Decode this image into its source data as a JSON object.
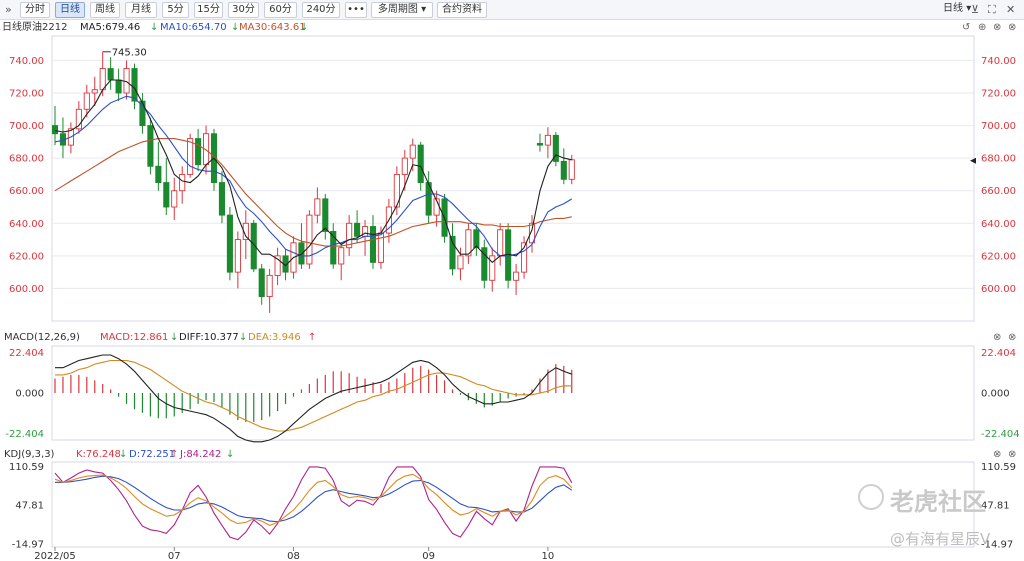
{
  "toolbar": {
    "collapse_icon": "double-chevron-right",
    "buttons": [
      "分时",
      "日线",
      "周线",
      "月线",
      "5分",
      "15分",
      "30分",
      "60分",
      "240分"
    ],
    "active": "日线",
    "more_label": "•••",
    "multi_period_label": "多周期图",
    "contract_info_label": "合约资料",
    "right_dropdown_label": "日线",
    "icons": [
      "minimize-icon",
      "fullscreen-icon",
      "close-icon"
    ]
  },
  "price_header": {
    "period": "日线",
    "symbol": "原油2212",
    "ma5": "MA5:679.46",
    "ma10": "MA10:654.70",
    "ma30": "MA30:643.61",
    "ma5_arrow": "↓",
    "ma10_arrow": "↓",
    "ma30_arrow": "↓"
  },
  "macd_header": {
    "name": "MACD(12,26,9)",
    "macd": "MACD:12.861",
    "diff": "DIFF:10.377",
    "dea": "DEA:3.946",
    "macd_arrow": "↓",
    "diff_arrow": "↓",
    "dea_arrow": "↑"
  },
  "kdj_header": {
    "name": "KDJ(9,3,3)",
    "k": "K:76.248",
    "d": "D:72.251",
    "j": "J:84.242",
    "k_arrow": "↓",
    "d_arrow": "↑",
    "j_arrow": "↓"
  },
  "panel_controls": [
    "refresh-icon",
    "add-icon",
    "close-icon"
  ],
  "x_axis_labels": [
    "2022/05",
    "07",
    "08",
    "09",
    "10"
  ],
  "watermark": {
    "brand": "老虎社区",
    "author": "@有海有星辰V"
  },
  "colors": {
    "up": "#d9363e",
    "down": "#1b8a2e",
    "ma5": "#222222",
    "ma10": "#2b50c8",
    "ma30": "#c0532a",
    "grid": "#e6e9ef"
  },
  "chart_data": [
    {
      "type": "candlestick",
      "title": "原油2212 日线",
      "y_ticks": [
        600,
        620,
        640,
        660,
        680,
        700,
        720,
        740
      ],
      "ylim": [
        580,
        755
      ],
      "annotation": "745.30",
      "candles": [
        [
          700,
          712,
          688,
          695
        ],
        [
          695,
          705,
          680,
          688
        ],
        [
          688,
          702,
          683,
          698
        ],
        [
          698,
          715,
          695,
          710
        ],
        [
          710,
          725,
          705,
          720
        ],
        [
          720,
          730,
          712,
          722
        ],
        [
          722,
          745.3,
          718,
          735
        ],
        [
          735,
          742,
          722,
          728
        ],
        [
          728,
          735,
          715,
          720
        ],
        [
          720,
          740,
          716,
          735
        ],
        [
          735,
          738,
          710,
          715
        ],
        [
          715,
          720,
          695,
          700
        ],
        [
          700,
          705,
          670,
          675
        ],
        [
          675,
          690,
          660,
          665
        ],
        [
          665,
          680,
          645,
          650
        ],
        [
          650,
          668,
          642,
          660
        ],
        [
          660,
          675,
          652,
          670
        ],
        [
          670,
          695,
          668,
          692
        ],
        [
          692,
          698,
          672,
          676
        ],
        [
          676,
          700,
          670,
          695
        ],
        [
          695,
          698,
          660,
          665
        ],
        [
          665,
          672,
          640,
          645
        ],
        [
          645,
          650,
          605,
          610
        ],
        [
          610,
          635,
          600,
          630
        ],
        [
          630,
          648,
          618,
          640
        ],
        [
          640,
          642,
          610,
          612
        ],
        [
          612,
          615,
          590,
          595
        ],
        [
          595,
          612,
          585,
          608
        ],
        [
          608,
          625,
          602,
          620
        ],
        [
          620,
          624,
          605,
          610
        ],
        [
          610,
          632,
          606,
          628
        ],
        [
          628,
          640,
          612,
          615
        ],
        [
          615,
          648,
          612,
          645
        ],
        [
          645,
          662,
          640,
          655
        ],
        [
          655,
          658,
          630,
          635
        ],
        [
          635,
          640,
          612,
          615
        ],
        [
          615,
          628,
          605,
          625
        ],
        [
          625,
          645,
          620,
          640
        ],
        [
          640,
          648,
          628,
          632
        ],
        [
          632,
          642,
          620,
          638
        ],
        [
          638,
          645,
          612,
          616
        ],
        [
          616,
          638,
          612,
          634
        ],
        [
          634,
          655,
          628,
          650
        ],
        [
          650,
          675,
          645,
          670
        ],
        [
          670,
          685,
          660,
          680
        ],
        [
          680,
          692,
          672,
          688
        ],
        [
          688,
          690,
          660,
          665
        ],
        [
          665,
          672,
          640,
          645
        ],
        [
          645,
          660,
          638,
          655
        ],
        [
          655,
          658,
          628,
          632
        ],
        [
          632,
          640,
          608,
          612
        ],
        [
          612,
          625,
          605,
          620
        ],
        [
          620,
          640,
          615,
          636
        ],
        [
          636,
          640,
          620,
          625
        ],
        [
          625,
          630,
          600,
          605
        ],
        [
          605,
          625,
          598,
          620
        ],
        [
          620,
          640,
          614,
          636
        ],
        [
          636,
          640,
          600,
          605
        ],
        [
          605,
          615,
          596,
          610
        ],
        [
          610,
          632,
          606,
          628
        ],
        [
          628,
          645,
          622,
          640
        ],
        [
          689,
          695,
          684,
          688
        ],
        [
          688,
          699,
          680,
          694
        ],
        [
          694,
          696,
          675,
          678
        ],
        [
          678,
          686,
          664,
          667
        ],
        [
          667,
          682,
          664,
          679
        ]
      ],
      "ma5": [
        697,
        696,
        697,
        700,
        707,
        713,
        722,
        728,
        728,
        727,
        723,
        714,
        704,
        692,
        682,
        670,
        666,
        665,
        669,
        676,
        680,
        674,
        663,
        644,
        632,
        627,
        621,
        621,
        618,
        614,
        619,
        621,
        626,
        633,
        637,
        632,
        627,
        630,
        631,
        634,
        633,
        634,
        642,
        651,
        663,
        676,
        675,
        664,
        654,
        643,
        628,
        621,
        621,
        626,
        621,
        616,
        620,
        621,
        620,
        625,
        636,
        660,
        675,
        682,
        680,
        679
      ],
      "ma10": [
        690,
        691,
        693,
        696,
        700,
        705,
        710,
        714,
        716,
        718,
        717,
        712,
        707,
        700,
        694,
        687,
        680,
        675,
        673,
        672,
        672,
        670,
        666,
        657,
        650,
        646,
        641,
        635,
        630,
        624,
        622,
        620,
        620,
        622,
        625,
        627,
        628,
        630,
        630,
        632,
        632,
        633,
        637,
        642,
        648,
        654,
        656,
        658,
        658,
        656,
        652,
        647,
        642,
        638,
        632,
        624,
        620,
        620,
        621,
        623,
        627,
        638,
        647,
        650,
        652,
        655
      ],
      "ma30": [
        660,
        663,
        666,
        669,
        672,
        675,
        678,
        681,
        684,
        686,
        688,
        690,
        691,
        692,
        692,
        692,
        691,
        690,
        688,
        685,
        681,
        676,
        670,
        664,
        658,
        653,
        648,
        643,
        638,
        634,
        631,
        629,
        628,
        627,
        626,
        626,
        626,
        627,
        628,
        629,
        630,
        631,
        632,
        634,
        636,
        638,
        639,
        640,
        641,
        641,
        641,
        641,
        640,
        640,
        639,
        639,
        638,
        638,
        638,
        638,
        639,
        641,
        642,
        643,
        643,
        644
      ]
    },
    {
      "type": "bar",
      "title": "MACD(12,26,9)",
      "y_ticks": [
        -22.404,
        0.0,
        22.404
      ],
      "ylim": [
        -26,
        26
      ],
      "macd": [
        8,
        9,
        10,
        10,
        9,
        7,
        5,
        2,
        -2,
        -6,
        -9,
        -11,
        -13,
        -14,
        -14,
        -13,
        -11,
        -9,
        -6,
        -4,
        -5,
        -8,
        -12,
        -15,
        -16,
        -16,
        -15,
        -13,
        -10,
        -6,
        -2,
        2,
        5,
        8,
        10,
        12,
        12,
        11,
        9,
        8,
        6,
        5,
        6,
        8,
        11,
        14,
        15,
        13,
        10,
        7,
        2,
        -1,
        -4,
        -6,
        -8,
        -7,
        -5,
        -3,
        -2,
        -1,
        2,
        8,
        13,
        16,
        15,
        12.861
      ],
      "diff": [
        14,
        14,
        16,
        18,
        19,
        20,
        21,
        21,
        19,
        16,
        12,
        7,
        2,
        -3,
        -6,
        -8,
        -9,
        -10,
        -11,
        -12,
        -14,
        -17,
        -20,
        -24,
        -26,
        -27,
        -27,
        -26,
        -24,
        -21,
        -17,
        -13,
        -9,
        -6,
        -3,
        -1,
        1,
        2,
        3,
        4,
        5,
        6,
        8,
        11,
        14,
        17,
        18,
        17,
        14,
        10,
        5,
        1,
        -2,
        -4,
        -6,
        -6,
        -5,
        -5,
        -4,
        -3,
        0,
        6,
        11,
        14,
        12,
        10.377
      ],
      "dea": [
        10,
        10,
        11,
        13,
        14,
        16,
        17,
        18,
        18,
        18,
        17,
        15,
        13,
        10,
        7,
        4,
        1,
        -1,
        -3,
        -5,
        -6,
        -8,
        -10,
        -13,
        -15,
        -17,
        -19,
        -20,
        -21,
        -21,
        -20,
        -19,
        -17,
        -15,
        -13,
        -11,
        -9,
        -7,
        -5,
        -4,
        -2,
        -1,
        1,
        2,
        4,
        6,
        8,
        10,
        11,
        11,
        10,
        9,
        7,
        5,
        4,
        2,
        1,
        0,
        -1,
        -1,
        -1,
        0,
        1,
        3,
        4,
        3.946
      ]
    },
    {
      "type": "line",
      "title": "KDJ(9,3,3)",
      "y_ticks": [
        -14.97,
        47.81,
        110.59
      ],
      "ylim": [
        -20,
        118
      ],
      "k": [
        90,
        85,
        88,
        92,
        95,
        96,
        97,
        92,
        85,
        75,
        62,
        50,
        42,
        36,
        30,
        32,
        40,
        52,
        60,
        55,
        45,
        35,
        24,
        18,
        20,
        26,
        22,
        15,
        20,
        30,
        40,
        55,
        72,
        85,
        88,
        78,
        65,
        60,
        62,
        60,
        56,
        62,
        75,
        88,
        95,
        98,
        90,
        75,
        65,
        52,
        40,
        32,
        35,
        42,
        36,
        30,
        38,
        40,
        32,
        38,
        55,
        80,
        92,
        96,
        90,
        76.248
      ],
      "d": [
        85,
        85,
        86,
        88,
        90,
        93,
        95,
        94,
        91,
        85,
        77,
        68,
        59,
        51,
        44,
        40,
        40,
        44,
        50,
        52,
        50,
        45,
        38,
        31,
        28,
        27,
        26,
        22,
        21,
        24,
        29,
        38,
        49,
        61,
        70,
        73,
        70,
        67,
        65,
        63,
        60,
        61,
        66,
        73,
        81,
        87,
        88,
        84,
        77,
        68,
        59,
        50,
        45,
        44,
        41,
        37,
        38,
        39,
        37,
        37,
        43,
        55,
        67,
        77,
        81,
        72.251
      ],
      "j": [
        100,
        85,
        92,
        100,
        105,
        102,
        100,
        88,
        73,
        55,
        32,
        14,
        8,
        6,
        2,
        16,
        40,
        68,
        80,
        61,
        35,
        15,
        -4,
        -8,
        4,
        24,
        14,
        1,
        18,
        42,
        62,
        89,
        110,
        110,
        108,
        88,
        55,
        46,
        56,
        54,
        48,
        64,
        93,
        110,
        110,
        110,
        94,
        57,
        41,
        20,
        2,
        -4,
        15,
        38,
        26,
        16,
        38,
        42,
        22,
        40,
        79,
        110,
        110,
        110,
        108,
        84.242
      ]
    }
  ]
}
